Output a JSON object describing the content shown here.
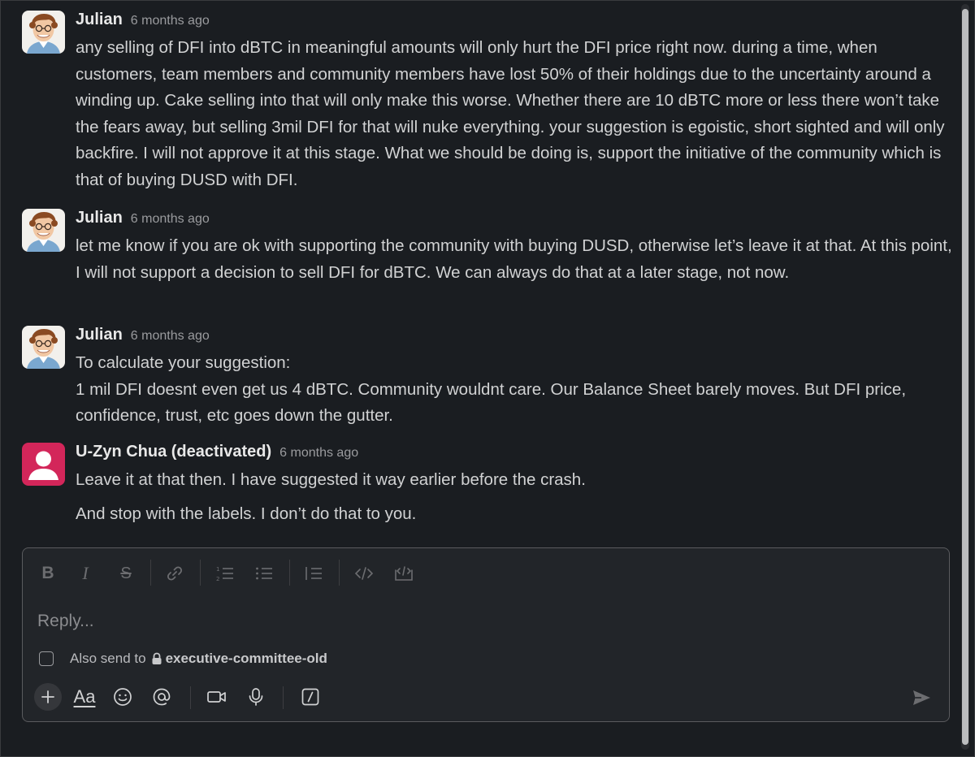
{
  "messages": [
    {
      "author": "Julian",
      "time": "6 months ago",
      "paragraphs": [
        "any selling of DFI into dBTC in meaningful amounts will only hurt the DFI price right now. during a time, when customers, team members and community members have lost 50% of their holdings due to the uncertainty around a winding up. Cake selling into that will only make this worse. Whether there are 10 dBTC more or less there won’t take the fears away, but selling 3mil DFI for that will nuke everything. your suggestion is egoistic, short sighted and will only backfire. I will not approve it at this stage. What we should be doing is, support the initiative of the community which is that of buying DUSD with DFI."
      ]
    },
    {
      "author": "Julian",
      "time": "6 months ago",
      "paragraphs": [
        "let me know if you are ok with supporting the community with buying DUSD, otherwise let’s leave it at that. At this point, I will not support a decision to sell DFI for dBTC. We can always do that at a later stage, not now."
      ]
    },
    {
      "author": "Julian",
      "time": "6 months ago",
      "paragraphs": [
        "To calculate your suggestion:",
        "1 mil DFI doesnt even get us 4 dBTC. Community wouldnt care. Our Balance Sheet barely moves. But DFI price, confidence, trust, etc goes down the gutter."
      ]
    },
    {
      "author": "U-Zyn Chua (deactivated)",
      "time": "6 months ago",
      "paragraphs": [
        "Leave it at that then. I have suggested it way earlier before the crash.",
        "And stop with the labels. I don’t do that to you."
      ]
    }
  ],
  "composer": {
    "placeholder": "Reply...",
    "also_send_label": "Also send to",
    "channel": "executive-committee-old",
    "format_label": "Aa"
  },
  "colors": {
    "background": "#1a1d21",
    "composer_bg": "#222529",
    "deactivated_avatar": "#d3265a",
    "text": "#d1d2d3"
  }
}
